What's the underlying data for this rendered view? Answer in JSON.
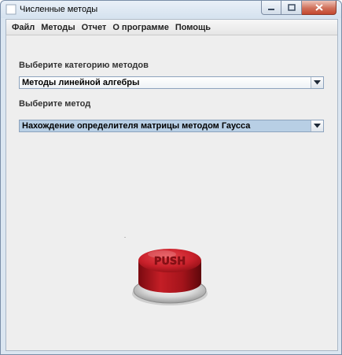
{
  "window": {
    "title": "Численные методы"
  },
  "menu": {
    "items": [
      "Файл",
      "Методы",
      "Отчет",
      "О программе",
      "Помощь"
    ]
  },
  "category": {
    "label": "Выберите категорию методов",
    "selected": "Методы линейной алгебры"
  },
  "method": {
    "label": "Выберите метод",
    "selected": "Нахождение определителя матрицы методом Гаусса"
  },
  "push_button": {
    "text": "PUSH"
  },
  "colors": {
    "selection": "#b8cfe5",
    "button_red": "#c8202a"
  }
}
